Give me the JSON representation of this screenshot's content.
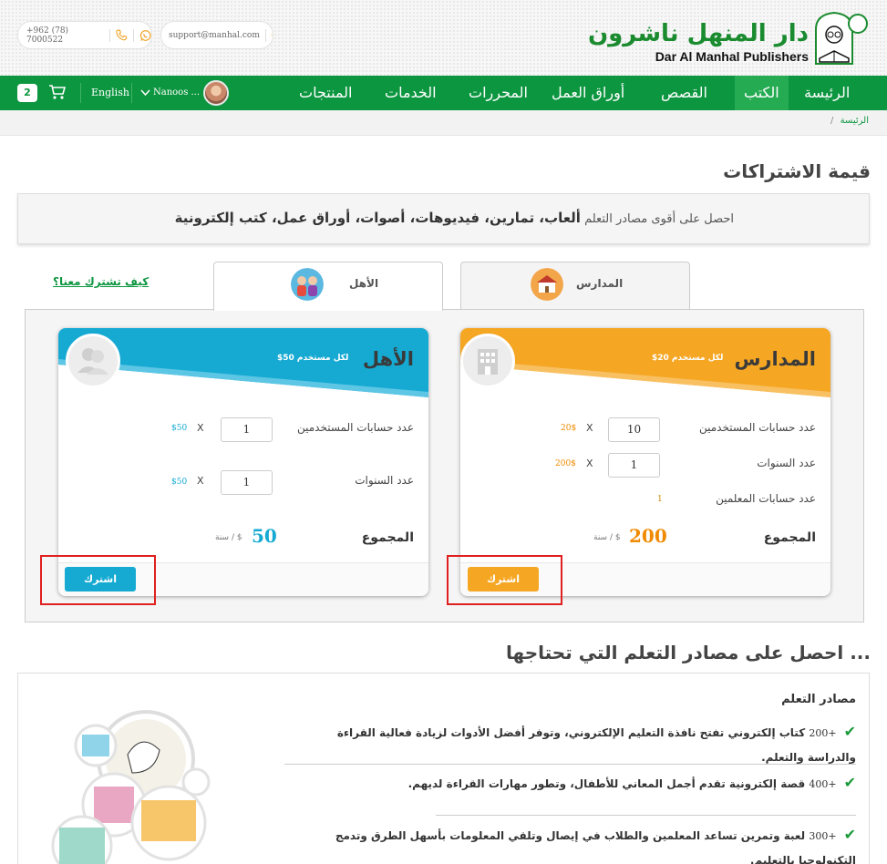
{
  "header": {
    "phone": "+962 (78) 7000522",
    "email": "support@manhal.com",
    "logo_ar": "دار المنهل ناشرون",
    "logo_en": "Dar Al Manhal Publishers"
  },
  "nav": {
    "items": [
      "الرئيسة",
      "الكتب",
      "القصص",
      "أوراق العمل",
      "المحررات",
      "الخدمات",
      "المنتجات"
    ],
    "active": "الكتب",
    "language": "English",
    "user": "Nanoos ...",
    "cart_count": "2"
  },
  "breadcrumb": {
    "home": "الرئيسة",
    "sep": "/"
  },
  "page": {
    "title": "قيمة الاشتراكات",
    "promo_lead": "احصل على أقوى مصادر التعلم",
    "promo_bold": "ألعاب، تمارين، فيديوهات، أصوات، أوراق عمل، كتب إلكترونية",
    "how_link": "كيف تشترك معنا؟"
  },
  "tabs": {
    "schools": "المدارس",
    "parents": "الأهل"
  },
  "school_card": {
    "title": "المدارس",
    "per_user": "لكل مستخدم 20$",
    "users_label": "عدد حسابات المستخدمين",
    "users_qty": "10",
    "users_price": "20$",
    "years_label": "عدد السنوات",
    "years_qty": "1",
    "years_price": "200$",
    "teachers_label": "عدد حسابات المعلمين",
    "teachers_count": "1",
    "total_label": "المجموع",
    "total_value": "200",
    "total_unit": "$ / سنة",
    "subscribe": "اشترك"
  },
  "parent_card": {
    "title": "الأهل",
    "per_user": "لكل مستخدم 50$",
    "users_label": "عدد حسابات المستخدمين",
    "users_qty": "1",
    "users_price": "$50",
    "years_label": "عدد السنوات",
    "years_qty": "1",
    "years_price": "$50",
    "total_label": "المجموع",
    "total_value": "50",
    "total_unit": "$ / سنة",
    "subscribe": "اشترك"
  },
  "section2": {
    "title": "... احصل على مصادر التعلم التي تحتاجها",
    "heading": "مصادر التعلم",
    "features": [
      {
        "num": "+200",
        "text": "كتاب إلكتروني تفتح نافذة التعليم الإلكتروني، وتوفر أفضل الأدوات لزيادة فعالية القراءة والدراسة والتعلم."
      },
      {
        "num": "+400",
        "text": "قصة إلكترونية تقدم أجمل المعاني للأطفال، وتطور مهارات القراءة لديهم."
      },
      {
        "num": "+300",
        "text": "لعبة وتمرين تساعد المعلمين والطلاب في إيصال وتلقي المعلومات بأسهل الطرق وتدمج التكنولوجيا بالتعليم."
      }
    ]
  },
  "colors": {
    "green": "#0d9640",
    "orange": "#f5a623",
    "blue": "#16aad3",
    "highlight": "#e02020"
  }
}
